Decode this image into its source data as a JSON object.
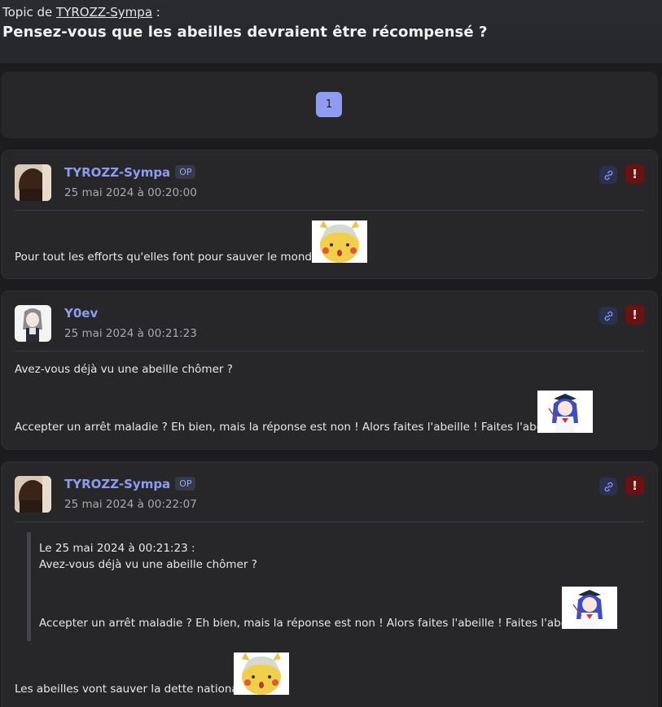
{
  "header": {
    "topic_prefix": "Topic de",
    "topic_author": "TYROZZ-Sympa",
    "topic_suffix": ":",
    "title": "Pensez-vous que les abeilles devraient être récompensé ?"
  },
  "pagination": {
    "current_page": "1"
  },
  "posts": [
    {
      "author": "TYROZZ-Sympa",
      "badge": "OP",
      "date": "25 mai 2024 à 00:20:00",
      "lines": [
        "Pour tout les efforts qu'elles font pour sauver le monde"
      ],
      "sticker": "pikachu-sticker"
    },
    {
      "author": "Y0ev",
      "date": "25 mai 2024 à 00:21:23",
      "lines": [
        "Avez-vous déjà vu une abeille chômer ?",
        "Accepter un arrêt maladie ? Eh bien, mais la réponse est non ! Alors faites l'abeille ! Faites l'abeille !"
      ],
      "sticker": "anime-girl-sticker"
    },
    {
      "author": "TYROZZ-Sympa",
      "badge": "OP",
      "date": "25 mai 2024 à 00:22:07",
      "quote": {
        "header": "Le 25 mai 2024 à 00:21:23 :",
        "lines": [
          "Avez-vous déjà vu une abeille chômer ?",
          "Accepter un arrêt maladie ? Eh bien, mais la réponse est non ! Alors faites l'abeille ! Faites l'abeille !"
        ]
      },
      "lines": [
        "Les abeilles vont sauver la dette national"
      ],
      "sticker": "pikachu-sticker"
    }
  ],
  "icons": {
    "link": "link-icon",
    "report": "report-icon",
    "report_glyph": "!"
  },
  "colors": {
    "accent": "#8c9cf0",
    "report": "#6a1111",
    "page_button": "#8f9cf1",
    "background": "#1c1c1e",
    "card": "#27272a"
  }
}
